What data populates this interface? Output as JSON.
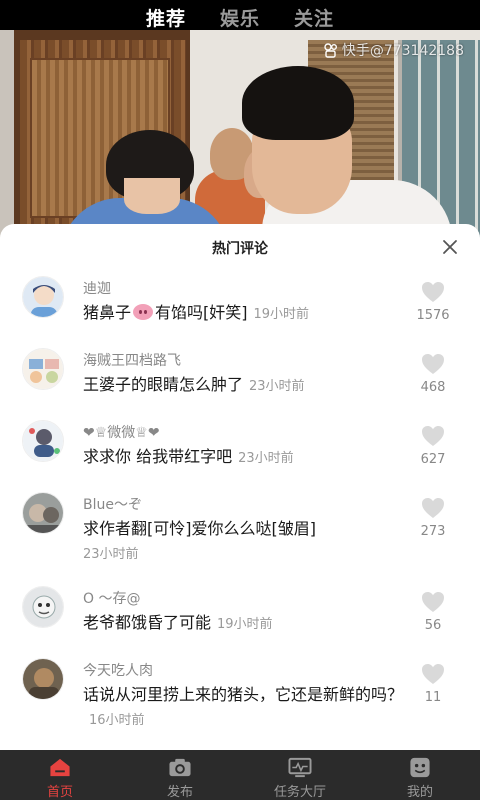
{
  "top_tabs": [
    {
      "label": "推荐",
      "active": true
    },
    {
      "label": "娱乐",
      "active": false
    },
    {
      "label": "关注",
      "active": false
    }
  ],
  "watermark": {
    "icon": "kuaishou-logo-icon",
    "text": "快手@773142188"
  },
  "comment_panel": {
    "title": "热门评论",
    "close_icon": "close-icon",
    "comments": [
      {
        "name": "迪迦",
        "text": "猪鼻子",
        "emoji": "pig-nose-emoji",
        "text_after": "有馅吗[奸笑]",
        "time": "19小时前",
        "likes": "1576"
      },
      {
        "name": "海贼王四档路飞",
        "text": "王婆子的眼睛怎么肿了",
        "time": "23小时前",
        "likes": "468"
      },
      {
        "name": "❤♕微微♕❤",
        "text": "求求你 给我带红字吧",
        "time": "23小时前",
        "likes": "627"
      },
      {
        "name": "Blue～ぞ",
        "text": "求作者翻[可怜]爱你么么哒[皱眉]",
        "time": "23小时前",
        "likes": "273"
      },
      {
        "name": "O ～存@",
        "text": "老爷都饿昏了可能",
        "time": "19小时前",
        "likes": "56"
      },
      {
        "name": "今天吃人肉",
        "text": "话说从河里捞上来的猪头，它还是新鲜的吗？",
        "time": "16小时前",
        "likes": "11"
      }
    ]
  },
  "bottom_nav": [
    {
      "label": "首页",
      "icon": "home-icon",
      "active": true
    },
    {
      "label": "发布",
      "icon": "camera-icon",
      "active": false
    },
    {
      "label": "任务大厅",
      "icon": "monitor-icon",
      "active": false
    },
    {
      "label": "我的",
      "icon": "profile-icon",
      "active": false
    }
  ],
  "colors": {
    "accent": "#e64340",
    "like_gray": "#d9d9d9",
    "nav_bg": "#2b2b2b"
  }
}
